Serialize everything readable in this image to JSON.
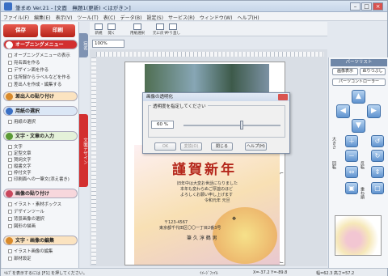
{
  "window": {
    "title": "筆まめ Ver.21 - [文面　無題1(更新) ＜はがき＞]"
  },
  "menu": [
    "ファイル(F)",
    "編集(E)",
    "表示(V)",
    "ツール(T)",
    "表(C)",
    "データ(B)",
    "設定(S)",
    "サービス(R)",
    "ウィンドウ(W)",
    "ヘルプ(H)"
  ],
  "left": {
    "save_label": "保存",
    "print_label": "印刷",
    "opening_menu": "オープニングメニュー",
    "opening_items": [
      "オープニングメニューの表示",
      "宛名面を作る",
      "デザイン面を作る",
      "住所録からラベルなどを作る",
      "差出人を作成・編集する"
    ],
    "sender_paste": "差出人の貼り付け",
    "paper_select": "用紙の選択",
    "paper_item": "用紙の選択",
    "text_input": "文字・文章の入力",
    "text_items": [
      "文字",
      "定型文章",
      "賀詞文字",
      "縦書文字",
      "枠付文字",
      "印刷面への一筆文(添え書き)"
    ],
    "image_paste": "画像の貼り付け",
    "image_items": [
      "イラスト・素材ボックス",
      "デザインツール",
      "背景画像の選択",
      "図形の描画"
    ],
    "text_image_edit": "文字・画像の編集",
    "edit_items": [
      "イラスト画像の編集",
      "部材設定"
    ],
    "vtabs": [
      "文面デザイン",
      "宛名"
    ]
  },
  "toolbar": {
    "buttons": [
      "新規",
      "開く",
      "用紙選択",
      "元に戻す",
      "やり直し"
    ],
    "zoom": "100%"
  },
  "card": {
    "title": "謹賀新年",
    "greeting_lines": [
      "旧年中は大変お世話になりました",
      "本年も変わらぬご厚誼のほど",
      "よろしくお願い申し上げます",
      "令和元年 元旦"
    ],
    "postcode": "〒123-4567",
    "address": "東京都千代田区〇〇一丁目2番3号",
    "name": "筆 久 淳 鶴 男"
  },
  "dialog": {
    "title": "画像の透明化",
    "group_label": "透明度を指定してください",
    "value": "60 %",
    "slider_level": 0.6,
    "buttons": [
      "OK",
      "変換(O)",
      "閉じる",
      "ヘルプ(H)"
    ]
  },
  "right": {
    "parts_title": "パーツリスト",
    "btn1": "画像表示",
    "btn2": "ぬりつぶし",
    "btn3": "パーツコントローラー",
    "labels": [
      "大きさ",
      "回転",
      "反転",
      "重ね順"
    ]
  },
  "status": {
    "hint": "ﾍﾙﾌﾟを表示するには [F1] を押してください。",
    "layer": "ｲﾒｰｼﾞﾌｧｲﾙ",
    "pos": "X=-37.2 Y=-89.8",
    "size": "幅=62.3 高さ=57.2"
  },
  "colors": {
    "accent_red": "#d32f2f",
    "accent_blue": "#3a6fc4",
    "title_red": "#b5271b"
  }
}
